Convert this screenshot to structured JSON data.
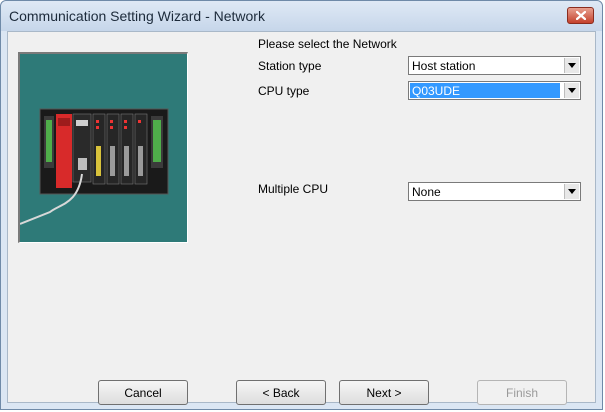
{
  "window": {
    "title": "Communication Setting Wizard - Network"
  },
  "form": {
    "heading": "Please select the Network",
    "station_type": {
      "label": "Station type",
      "value": "Host station"
    },
    "cpu_type": {
      "label": "CPU type",
      "value": "Q03UDE"
    },
    "multiple_cpu": {
      "label": "Multiple CPU",
      "value": "None"
    }
  },
  "buttons": {
    "cancel": "Cancel",
    "back": "< Back",
    "next": "Next >",
    "finish": "Finish"
  },
  "colors": {
    "image_background": "#2e7a78",
    "close_button": "#c4412c",
    "selection": "#3399ff"
  },
  "icons": {
    "close": "close-icon",
    "dropdown": "chevron-down-icon",
    "illustration": "plc-rack-illustration"
  }
}
